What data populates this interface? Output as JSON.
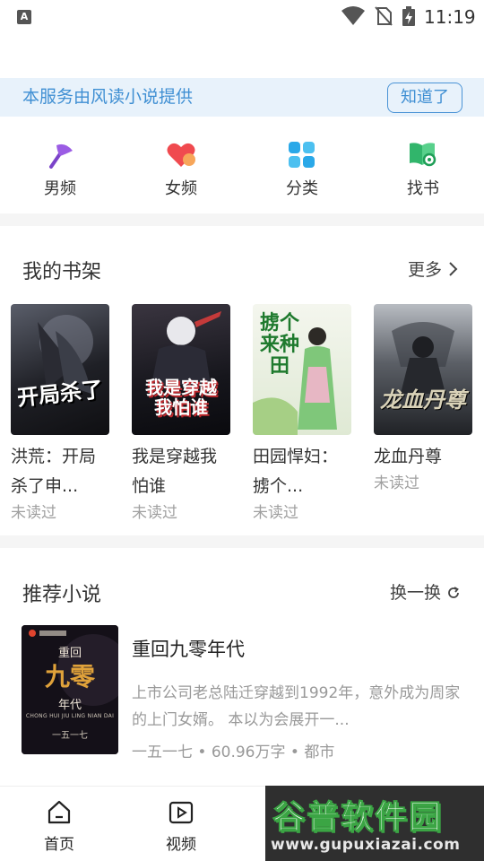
{
  "status_bar": {
    "time": "11:19",
    "app_icon_letter": "A"
  },
  "notice": {
    "text": "本服务由风读小说提供",
    "button_label": "知道了"
  },
  "categories": [
    {
      "label": "男频",
      "icon": "axe-icon",
      "color": "#8a4fd6"
    },
    {
      "label": "女频",
      "icon": "heart-icon",
      "color": "#f0454c"
    },
    {
      "label": "分类",
      "icon": "grid-icon",
      "color": "#2aa8e8"
    },
    {
      "label": "找书",
      "icon": "book-search-icon",
      "color": "#2fbf71"
    }
  ],
  "bookshelf": {
    "title": "我的书架",
    "more_label": "更多",
    "books": [
      {
        "name": "洪荒：开局杀了申...",
        "status": "未读过",
        "cover_text": "开局杀了",
        "cover_bg": "#2a2a30"
      },
      {
        "name": "我是穿越我怕谁",
        "status": "未读过",
        "cover_text": "我是穿越我怕谁",
        "cover_bg": "#1c1d24"
      },
      {
        "name": "田园悍妇：掳个...",
        "status": "未读过",
        "cover_text": "掳个来种田",
        "cover_bg": "#e7efe0"
      },
      {
        "name": "龙血丹尊",
        "status": "未读过",
        "cover_text": "龙血丹尊",
        "cover_bg": "#3a3c40"
      }
    ]
  },
  "recommend": {
    "title": "推荐小说",
    "refresh_label": "换一换",
    "book": {
      "title": "重回九零年代",
      "description": "上市公司老总陆迁穿越到1992年，意外成为周家的上门女婿。 本以为会展开一...",
      "meta": "一五一七 • 60.96万字 • 都市",
      "cover_lines": [
        "重回",
        "九零",
        "年代"
      ],
      "cover_pinyin": "CHONG HUI JIU LING NIAN DAI",
      "cover_author": "一五一七"
    }
  },
  "bottom_nav": [
    {
      "label": "首页",
      "icon": "home-icon"
    },
    {
      "label": "视频",
      "icon": "video-play-icon"
    }
  ],
  "watermark": {
    "text": "谷普软件园",
    "url": "www.gupuxiazai.com"
  }
}
